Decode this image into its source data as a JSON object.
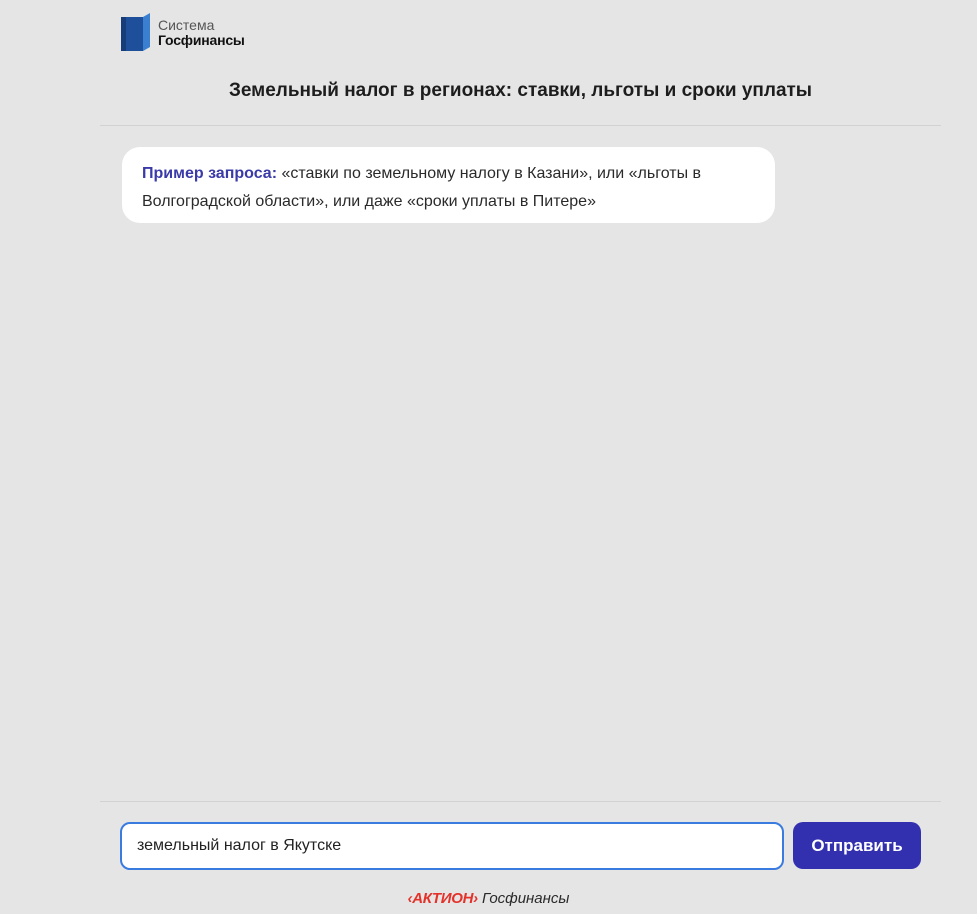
{
  "header": {
    "logo_line1": "Система",
    "logo_line2": "Госфинансы",
    "title": "Земельный налог в регионах: ставки, льготы и сроки уплаты"
  },
  "chat": {
    "hint_label": "Пример запроса:",
    "hint_text": " «ставки по земельному налогу в Казани», или «льготы в Волгоградской области», или даже «сроки уплаты в Питере»"
  },
  "composer": {
    "input_value": "земельный налог в Якутске",
    "send_label": "Отправить"
  },
  "footer": {
    "brand": "‹АКТИОН›",
    "product": " Госфинансы"
  },
  "colors": {
    "accent": "#3330b0",
    "hint_label": "#3a3aa8",
    "footer_brand": "#e4322b",
    "input_border": "#3a7be0",
    "background": "#e5e5e5"
  }
}
